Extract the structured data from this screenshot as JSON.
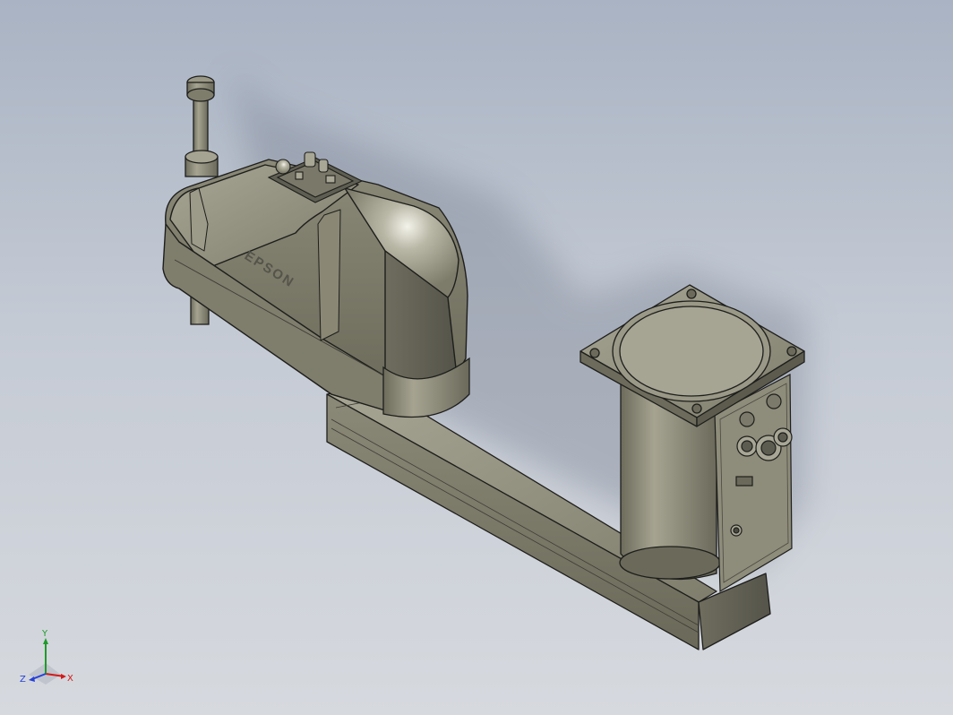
{
  "model": {
    "brand_label": "EPSON",
    "body_color": "#8c8a78",
    "outline_color": "#1e1e1c"
  },
  "triad": {
    "x_label": "X",
    "y_label": "Y",
    "z_label": "Z",
    "x_color": "#d21a1a",
    "y_color": "#1e9a2a",
    "z_color": "#2540d8"
  },
  "background": {
    "top_color": "#a9b3c3",
    "bottom_color": "#d6d9de"
  }
}
